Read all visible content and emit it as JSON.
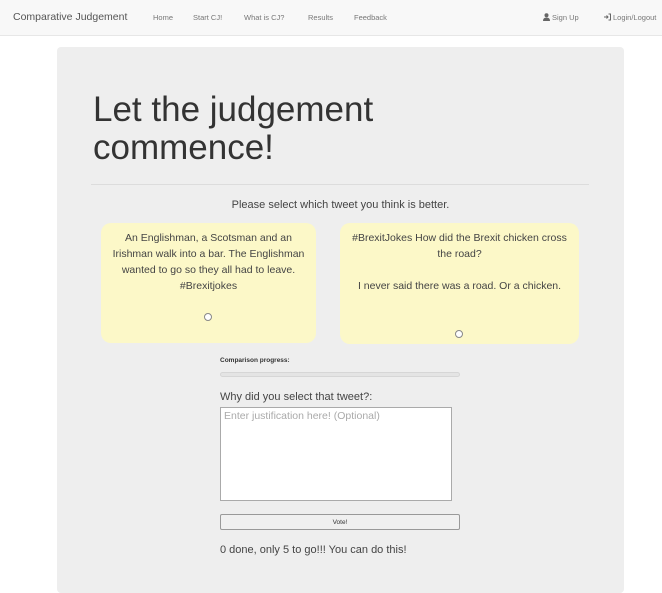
{
  "navbar": {
    "brand": "Comparative Judgement",
    "links": [
      "Home",
      "Start CJ!",
      "What is CJ?",
      "Results",
      "Feedback"
    ],
    "sign_up": "Sign Up",
    "login": "Login/Logout"
  },
  "main": {
    "title": "Let the judgement commence!",
    "instruction": "Please select which tweet you think is better.",
    "tweets": [
      {
        "text": "An Englishman, a Scotsman and an Irishman walk into a bar. The Englishman wanted to go so they all had to leave. #Brexitjokes"
      },
      {
        "text": "#BrexitJokes How did the Brexit chicken cross the road?\n\nI never said there was a road. Or a chicken."
      }
    ],
    "progress": {
      "label": "Comparison progress:",
      "value": 0
    },
    "justification": {
      "label": "Why did you select that tweet?:",
      "placeholder": "Enter justification here! (Optional)"
    },
    "vote_label": "Vote!",
    "status": "0 done, only 5 to go!!! You can do this!"
  },
  "colors": {
    "tweet_bg": "#fcf8c8",
    "panel_bg": "#eeeeee",
    "navbar_bg": "#f8f8f8"
  }
}
